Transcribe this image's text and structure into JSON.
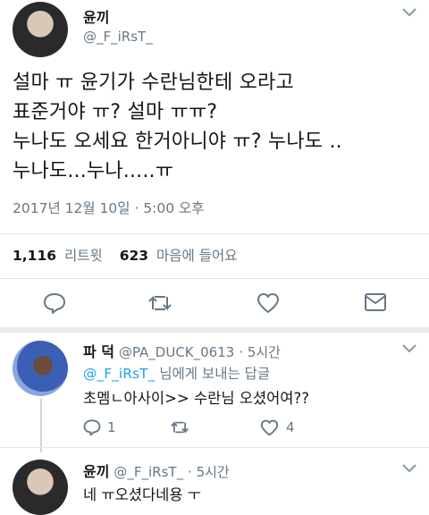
{
  "main_tweet": {
    "name": "윤끼",
    "handle": "@_F_iRsT_",
    "lines": [
      "설마 ㅠ 윤기가 수란님한테 오라고",
      "표준거야 ㅠ? 설마 ㅠㅠ?",
      "누나도 오세요 한거아니야 ㅠ? 누나도 ..",
      "누나도...누나.....ㅠ"
    ],
    "timestamp": "2017년 12월 10일 · 5:00 오후",
    "retweets_count": "1,116",
    "retweets_label": "리트윗",
    "likes_count": "623",
    "likes_label": "마음에 들어요"
  },
  "reply1": {
    "name": "파  덕",
    "handle": "@PA_DUCK_0613",
    "time": "· 5시간",
    "reply_to_handle": "@_F_iRsT_",
    "reply_to_suffix": " 님에게 보내는 답글",
    "text": "초멤ㄴ아사이>> 수란님 오셨어여??",
    "reply_count": "1",
    "like_count": "4"
  },
  "reply2": {
    "name": "윤끼",
    "handle": "@_F_iRsT_",
    "time": "· 5시간",
    "text": "네 ㅠ오셨다네용 ㅜ"
  },
  "icons": [
    "chevron-down-icon",
    "reply-icon",
    "retweet-icon",
    "heart-icon",
    "message-icon"
  ]
}
